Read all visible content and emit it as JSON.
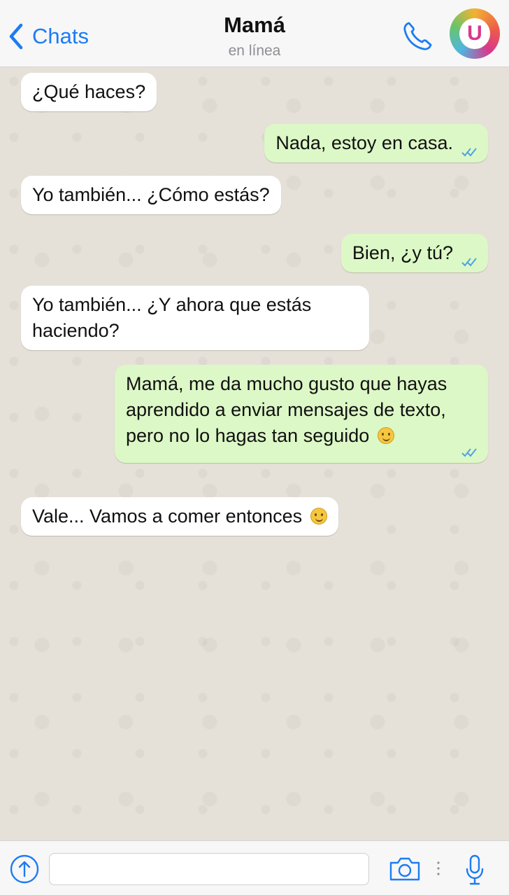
{
  "header": {
    "back_label": "Chats",
    "contact_name": "Mamá",
    "status": "en línea",
    "avatar_letter": "U"
  },
  "messages": [
    {
      "direction": "incoming",
      "text": "¿Qué haces?"
    },
    {
      "direction": "outgoing",
      "text": "Nada, estoy en casa.",
      "read": true
    },
    {
      "direction": "incoming",
      "text": "Yo también... ¿Cómo estás?"
    },
    {
      "direction": "outgoing",
      "text": "Bien, ¿y tú?",
      "read": true
    },
    {
      "direction": "incoming",
      "text": "Yo también... ¿Y ahora que estás haciendo?"
    },
    {
      "direction": "outgoing",
      "text": "Mamá, me da mucho gusto que hayas aprendido a enviar mensajes de texto, pero no lo hagas tan seguido",
      "emoji": "grinning-face",
      "read": true
    },
    {
      "direction": "incoming",
      "text": "Vale... Vamos a comer entonces",
      "emoji": "smiling-face"
    }
  ],
  "input": {
    "placeholder": ""
  },
  "colors": {
    "accent": "#1c7cf2",
    "outgoing_bubble": "#dcf8c6",
    "incoming_bubble": "#ffffff",
    "read_ticks": "#4fa3e0"
  },
  "icons": {
    "back": "chevron-left-icon",
    "call": "phone-icon",
    "upload": "upload-arrow-icon",
    "camera": "camera-icon",
    "mic": "microphone-icon"
  }
}
